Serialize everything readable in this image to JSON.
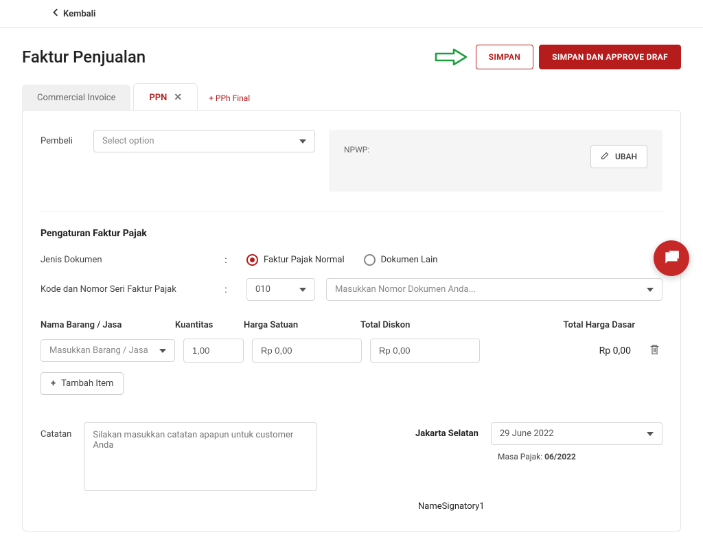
{
  "nav": {
    "back": "Kembali"
  },
  "header": {
    "title": "Faktur Penjualan",
    "save": "SIMPAN",
    "saveApprove": "SIMPAN DAN APPROVE DRAF"
  },
  "tabs": {
    "commercial": "Commercial Invoice",
    "ppn": "PPN",
    "addPph": "+ PPh Final"
  },
  "buyer": {
    "label": "Pembeli",
    "placeholder": "Select option"
  },
  "npwp": {
    "label": "NPWP:",
    "edit": "UBAH"
  },
  "settings": {
    "title": "Pengaturan Faktur Pajak",
    "docTypeLabel": "Jenis Dokumen",
    "docTypeNormal": "Faktur Pajak Normal",
    "docTypeOther": "Dokumen Lain",
    "serialLabel": "Kode dan Nomor Seri Faktur Pajak",
    "serialCode": "010",
    "serialPlaceholder": "Masukkan Nomor Dokumen Anda..."
  },
  "table": {
    "headers": {
      "nama": "Nama Barang / Jasa",
      "kty": "Kuantitas",
      "harga": "Harga Satuan",
      "diskon": "Total Diskon",
      "total": "Total Harga Dasar"
    },
    "row": {
      "namaPlaceholder": "Masukkan Barang / Jasa",
      "kty": "1,00",
      "harga": "Rp 0,00",
      "diskon": "Rp 0,00",
      "total": "Rp 0,00"
    },
    "addItem": "Tambah Item"
  },
  "footer": {
    "noteLabel": "Catatan",
    "notePlaceholder": "Silakan masukkan catatan apapun untuk customer Anda",
    "city": "Jakarta Selatan",
    "date": "29 June 2022",
    "taxPeriodLabel": "Masa Pajak: ",
    "taxPeriod": "06/2022",
    "signatory": "NameSignatory1"
  }
}
